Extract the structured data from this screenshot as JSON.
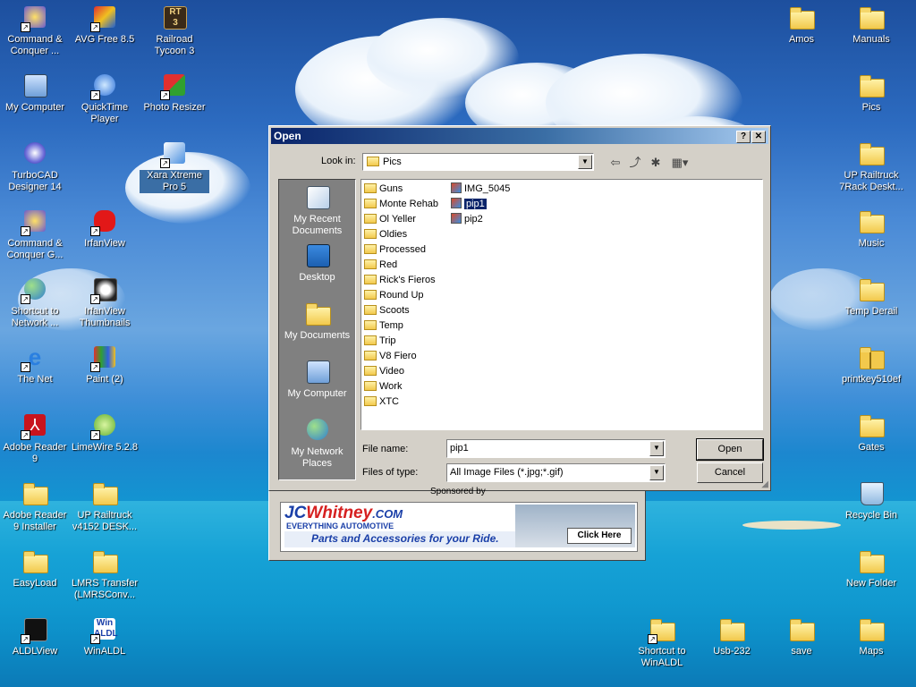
{
  "desktop": {
    "icons": [
      {
        "label": "Command & Conquer ...",
        "icon": "cnc-icon",
        "shortcut": true
      },
      {
        "label": "AVG Free 8.5",
        "icon": "avg-icon",
        "shortcut": true
      },
      {
        "label": "Railroad Tycoon 3",
        "icon": "rt3-icon",
        "shortcut": false
      },
      {
        "label": "Amos",
        "icon": "folder-icon",
        "shortcut": false
      },
      {
        "label": "Manuals",
        "icon": "folder-icon",
        "shortcut": false
      },
      {
        "label": "My Computer",
        "icon": "computer-icon",
        "shortcut": false
      },
      {
        "label": "QuickTime Player",
        "icon": "quicktime-icon",
        "shortcut": true
      },
      {
        "label": "Photo Resizer",
        "icon": "photo-resizer-icon",
        "shortcut": true
      },
      {
        "label": "Pics",
        "icon": "folder-icon",
        "shortcut": false
      },
      {
        "label": "TurboCAD Designer 14",
        "icon": "turbocad-icon",
        "shortcut": false
      },
      {
        "label": "Xara Xtreme Pro 5",
        "icon": "xara-icon",
        "shortcut": true
      },
      {
        "label": "UP Railtruck 7Rack Deskt...",
        "icon": "folder-icon",
        "shortcut": false
      },
      {
        "label": "Command & Conquer G...",
        "icon": "cnc-icon",
        "shortcut": true
      },
      {
        "label": "IrfanView",
        "icon": "irfanview-icon",
        "shortcut": true
      },
      {
        "label": "Music",
        "icon": "folder-icon",
        "shortcut": false
      },
      {
        "label": "Shortcut to Network ...",
        "icon": "network-icon",
        "shortcut": true
      },
      {
        "label": "IrfanView Thumbnails",
        "icon": "irfanview-thumbnails-icon",
        "shortcut": true
      },
      {
        "label": "Temp Derail",
        "icon": "folder-icon",
        "shortcut": false
      },
      {
        "label": "The Net",
        "icon": "ie-icon",
        "shortcut": true
      },
      {
        "label": "Paint (2)",
        "icon": "paint-icon",
        "shortcut": true
      },
      {
        "label": "printkey510ef",
        "icon": "zip-folder-icon",
        "shortcut": false
      },
      {
        "label": "Adobe Reader 9",
        "icon": "adobe-reader-icon",
        "shortcut": true
      },
      {
        "label": "LimeWire 5.2.8",
        "icon": "limewire-icon",
        "shortcut": true
      },
      {
        "label": "Gates",
        "icon": "folder-icon",
        "shortcut": false
      },
      {
        "label": "Adobe Reader 9 Installer",
        "icon": "folder-icon",
        "shortcut": false
      },
      {
        "label": "UP Railtruck v4152 DESK...",
        "icon": "folder-icon",
        "shortcut": false
      },
      {
        "label": "Recycle Bin",
        "icon": "recycle-bin-icon",
        "shortcut": false
      },
      {
        "label": "EasyLoad",
        "icon": "folder-icon",
        "shortcut": false
      },
      {
        "label": "LMRS Transfer (LMRSConv...",
        "icon": "folder-icon",
        "shortcut": false
      },
      {
        "label": "New Folder",
        "icon": "folder-icon",
        "shortcut": false
      },
      {
        "label": "ALDLView",
        "icon": "aldlview-icon",
        "shortcut": true
      },
      {
        "label": "WinALDL",
        "icon": "winaldl-icon",
        "shortcut": true
      },
      {
        "label": "Shortcut to WinALDL",
        "icon": "folder-icon",
        "shortcut": true
      },
      {
        "label": "Usb-232",
        "icon": "folder-icon",
        "shortcut": false
      },
      {
        "label": "save",
        "icon": "folder-icon",
        "shortcut": false
      },
      {
        "label": "Maps",
        "icon": "folder-icon",
        "shortcut": false
      }
    ]
  },
  "dialog": {
    "title": "Open",
    "help_label": "?",
    "close_label": "✕",
    "look_in_label": "Look in:",
    "look_in_value": "Pics",
    "places": [
      "My Recent Documents",
      "Desktop",
      "My Documents",
      "My Computer",
      "My Network Places"
    ],
    "folders": [
      "Guns",
      "Monte Rehab",
      "Ol Yeller",
      "Oldies",
      "Processed",
      "Red",
      "Rick's Fieros",
      "Round Up",
      "Scoots",
      "Temp",
      "Trip",
      "V8 Fiero",
      "Video",
      "Work",
      "XTC"
    ],
    "files": [
      "IMG_5045",
      "pip1",
      "pip2"
    ],
    "selected_file": "pip1",
    "file_name_label": "File name:",
    "file_name_value": "pip1",
    "file_type_label": "Files of type:",
    "file_type_value": "All Image Files (*.jpg;*.gif)",
    "open_button": "Open",
    "cancel_button": "Cancel"
  },
  "ad": {
    "sponsored_label": "Sponsored by",
    "brand_jc": "JC",
    "brand_whitney": "Whitney",
    "brand_com": ".COM",
    "tagline": "EVERYTHING AUTOMOTIVE",
    "slogan": "Parts and Accessories for your Ride.",
    "cta": "Click Here"
  },
  "colors": {
    "titlebar_start": "#0a246a",
    "selection": "#0a246a",
    "ad_brand_blue": "#1a3fa8",
    "ad_brand_red": "#d62020"
  }
}
